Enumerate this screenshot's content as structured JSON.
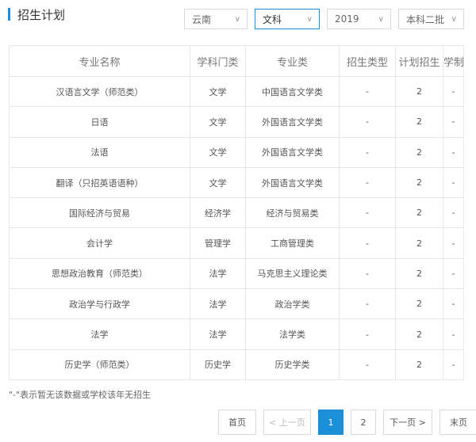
{
  "header": {
    "title": "招生计划"
  },
  "filters": {
    "province": "云南",
    "subject": "文科",
    "year": "2019",
    "batch": "本科二批",
    "chevron": "chevron-down-icon"
  },
  "table": {
    "columns": [
      "专业名称",
      "学科门类",
      "专业类",
      "招生类型",
      "计划招生",
      "学制"
    ],
    "rows": [
      [
        "汉语言文学（师范类）",
        "文学",
        "中国语言文学类",
        "-",
        "2",
        "-"
      ],
      [
        "日语",
        "文学",
        "外国语言文学类",
        "-",
        "2",
        "-"
      ],
      [
        "法语",
        "文学",
        "外国语言文学类",
        "-",
        "2",
        "-"
      ],
      [
        "翻译（只招英语语种）",
        "文学",
        "外国语言文学类",
        "-",
        "2",
        "-"
      ],
      [
        "国际经济与贸易",
        "经济学",
        "经济与贸易类",
        "-",
        "2",
        "-"
      ],
      [
        "会计学",
        "管理学",
        "工商管理类",
        "-",
        "2",
        "-"
      ],
      [
        "思想政治教育（师范类）",
        "法学",
        "马克思主义理论类",
        "-",
        "2",
        "-"
      ],
      [
        "政治学与行政学",
        "法学",
        "政治学类",
        "-",
        "2",
        "-"
      ],
      [
        "法学",
        "法学",
        "法学类",
        "-",
        "2",
        "-"
      ],
      [
        "历史学（师范类）",
        "历史学",
        "历史学类",
        "-",
        "2",
        "-"
      ]
    ]
  },
  "note": "\"-\"表示暂无该数据或学校该年无招生",
  "pagination": {
    "first": "首页",
    "prev": "< 上一页",
    "page1": "1",
    "page2": "2",
    "next": "下一页 >",
    "last": "末页"
  },
  "colors": {
    "accent": "#1b8fd8"
  }
}
